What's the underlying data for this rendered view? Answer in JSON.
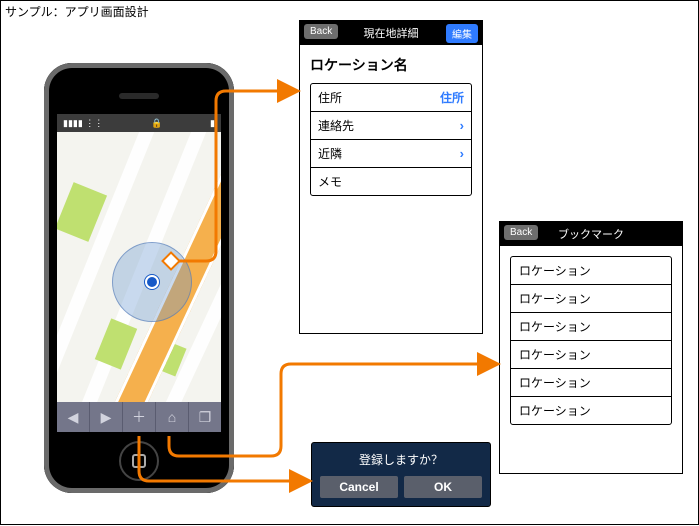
{
  "page_title": "サンプル：アプリ画面設計",
  "phone": {
    "toolbar_glyphs": [
      "◀",
      "▶",
      "＋",
      "⌂",
      "❐"
    ]
  },
  "detail": {
    "back": "Back",
    "title": "現在地詳細",
    "edit": "編集",
    "heading": "ロケーション名",
    "rows": [
      {
        "label": "住所",
        "trail": "住所",
        "trail_kind": "text"
      },
      {
        "label": "連絡先",
        "trail": "›",
        "trail_kind": "chev"
      },
      {
        "label": "近隣",
        "trail": "›",
        "trail_kind": "chev"
      },
      {
        "label": "メモ",
        "trail": "",
        "trail_kind": "none"
      }
    ]
  },
  "bookmark": {
    "back": "Back",
    "title": "ブックマーク",
    "items": [
      "ロケーション",
      "ロケーション",
      "ロケーション",
      "ロケーション",
      "ロケーション",
      "ロケーション"
    ]
  },
  "dialog": {
    "message": "登録しますか？",
    "cancel": "Cancel",
    "ok": "OK"
  }
}
